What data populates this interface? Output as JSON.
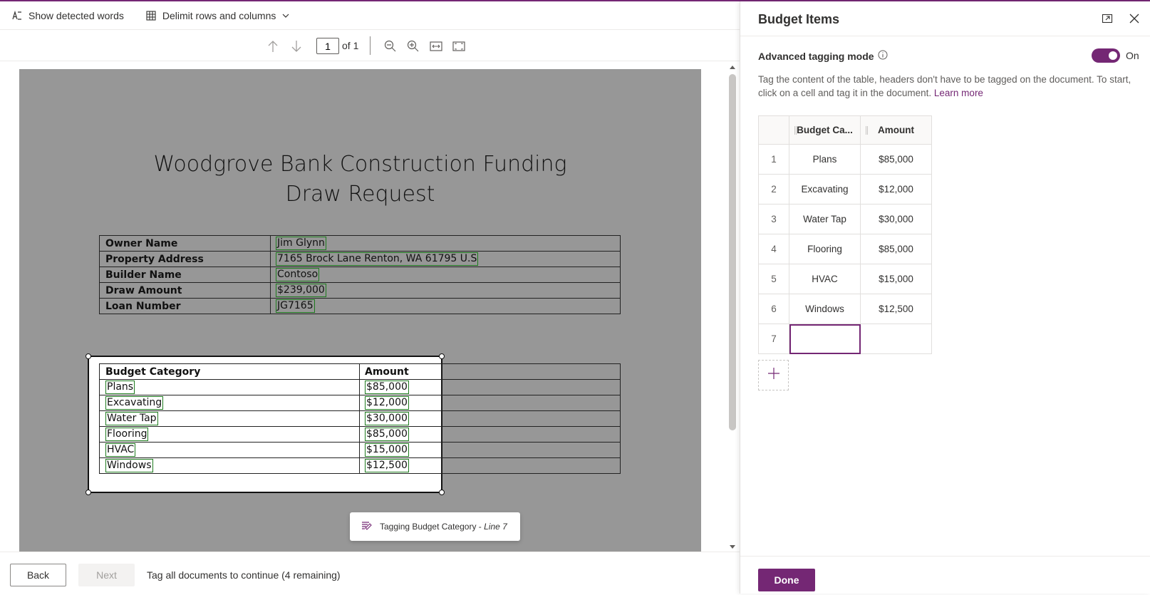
{
  "toolbar": {
    "show_words": "Show detected words",
    "delimit": "Delimit rows and columns"
  },
  "viewer": {
    "page_value": "1",
    "page_of": "of 1"
  },
  "document": {
    "title_line1": "Woodgrove Bank Construction Funding",
    "title_line2": "Draw Request",
    "info_rows": [
      {
        "key": "Owner Name",
        "value": "Jim Glynn"
      },
      {
        "key": "Property Address",
        "value": "7165 Brock Lane Renton, WA 61795 U.S"
      },
      {
        "key": "Builder Name",
        "value": "Contoso"
      },
      {
        "key": "Draw Amount",
        "value": "$239,000"
      },
      {
        "key": "Loan Number",
        "value": "JG7165"
      }
    ],
    "budget_header": {
      "category": "Budget Category",
      "amount": "Amount"
    },
    "budget_rows": [
      {
        "category": "Plans",
        "amount": "$85,000"
      },
      {
        "category": "Excavating",
        "amount": "$12,000"
      },
      {
        "category": "Water Tap",
        "amount": "$30,000"
      },
      {
        "category": "Flooring",
        "amount": "$85,000"
      },
      {
        "category": "HVAC",
        "amount": "$15,000"
      },
      {
        "category": "Windows",
        "amount": "$12,500"
      }
    ]
  },
  "toast": {
    "prefix": "Tagging",
    "field": "Budget Category",
    "sep": " - ",
    "line": "Line 7"
  },
  "footer": {
    "back": "Back",
    "next": "Next",
    "status": "Tag all documents to continue (4 remaining)"
  },
  "panel": {
    "title": "Budget Items",
    "adv_label": "Advanced tagging mode",
    "toggle_state": "On",
    "desc": "Tag the content of the table, headers don't have to be tagged on the document. To start, click on a cell and tag it in the document.",
    "learn_more": "Learn more",
    "col1": "Budget Ca...",
    "col2": "Amount",
    "rows": [
      {
        "n": "1",
        "category": "Plans",
        "amount": "$85,000"
      },
      {
        "n": "2",
        "category": "Excavating",
        "amount": "$12,000"
      },
      {
        "n": "3",
        "category": "Water Tap",
        "amount": "$30,000"
      },
      {
        "n": "4",
        "category": "Flooring",
        "amount": "$85,000"
      },
      {
        "n": "5",
        "category": "HVAC",
        "amount": "$15,000"
      },
      {
        "n": "6",
        "category": "Windows",
        "amount": "$12,500"
      },
      {
        "n": "7",
        "category": "",
        "amount": ""
      }
    ],
    "done": "Done"
  },
  "colors": {
    "accent": "#742774",
    "tag_box": "#1e7b1e"
  }
}
